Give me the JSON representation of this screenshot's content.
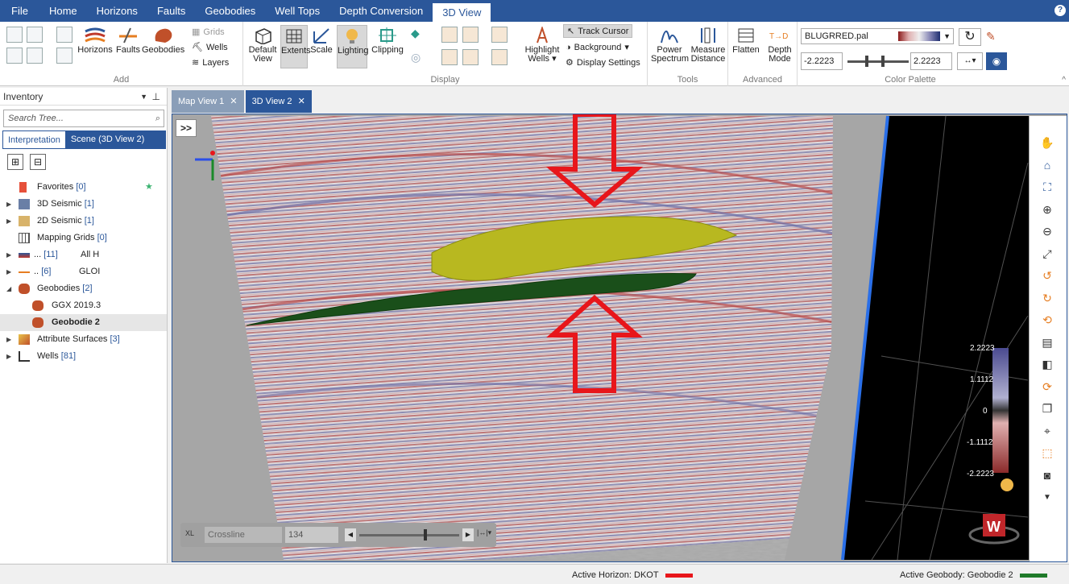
{
  "menu": {
    "items": [
      "File",
      "Home",
      "Horizons",
      "Faults",
      "Geobodies",
      "Well Tops",
      "Depth Conversion",
      "3D View"
    ],
    "active": "3D View"
  },
  "ribbon": {
    "add": {
      "label": "Add",
      "horizons": "Horizons",
      "faults": "Faults",
      "geobodies": "Geobodies",
      "grids": "Grids",
      "wells": "Wells",
      "layers": "Layers"
    },
    "display": {
      "label": "Display",
      "default_view": "Default View",
      "extents": "Extents",
      "scale": "Scale",
      "lighting": "Lighting",
      "clipping": "Clipping",
      "highlight_wells": "Highlight Wells",
      "track_cursor": "Track Cursor",
      "background": "Background",
      "display_settings": "Display Settings"
    },
    "tools": {
      "label": "Tools",
      "power_spectrum": "Power Spectrum",
      "measure_distance": "Measure Distance"
    },
    "advanced": {
      "label": "Advanced",
      "flatten": "Flatten",
      "depth_mode": "Depth Mode"
    },
    "palette": {
      "label": "Color Palette",
      "name": "BLUGRRED.pal",
      "min": "-2.2223",
      "max": "2.2223"
    }
  },
  "inventory": {
    "title": "Inventory",
    "search_placeholder": "Search Tree...",
    "tabs": [
      "Interpretation",
      "Scene (3D View 2)"
    ],
    "items": [
      {
        "label": "Favorites",
        "count": "[0]"
      },
      {
        "label": "3D Seismic",
        "count": "[1]"
      },
      {
        "label": "2D Seismic",
        "count": "[1]"
      },
      {
        "label": "Mapping Grids",
        "count": "[0]"
      },
      {
        "label": "...",
        "count": "[11]",
        "extra": "All H"
      },
      {
        "label": "..",
        "count": "[6]",
        "extra": "GLOI"
      },
      {
        "label": "Geobodies",
        "count": "[2]"
      },
      {
        "label": "GGX  2019.3",
        "count": ""
      },
      {
        "label": "Geobodie  2",
        "count": ""
      },
      {
        "label": "Attribute Surfaces",
        "count": "[3]"
      },
      {
        "label": "Wells",
        "count": "[81]"
      }
    ]
  },
  "doc_tabs": [
    "Map View 1",
    "3D View 2"
  ],
  "view": {
    "expand_label": ">>",
    "crossline_label": "Crossline",
    "crossline_value": "134",
    "colorbar_ticks": [
      "2.2223",
      "1.1112",
      "0",
      "-1.1112",
      "-2.2223"
    ],
    "badge_letter": "W"
  },
  "status": {
    "active_horizon": "Active Horizon: DKOT",
    "active_horizon_color": "#e8161b",
    "active_geobody": "Active Geobody: Geobodie  2",
    "active_geobody_color": "#1f7a2a"
  }
}
